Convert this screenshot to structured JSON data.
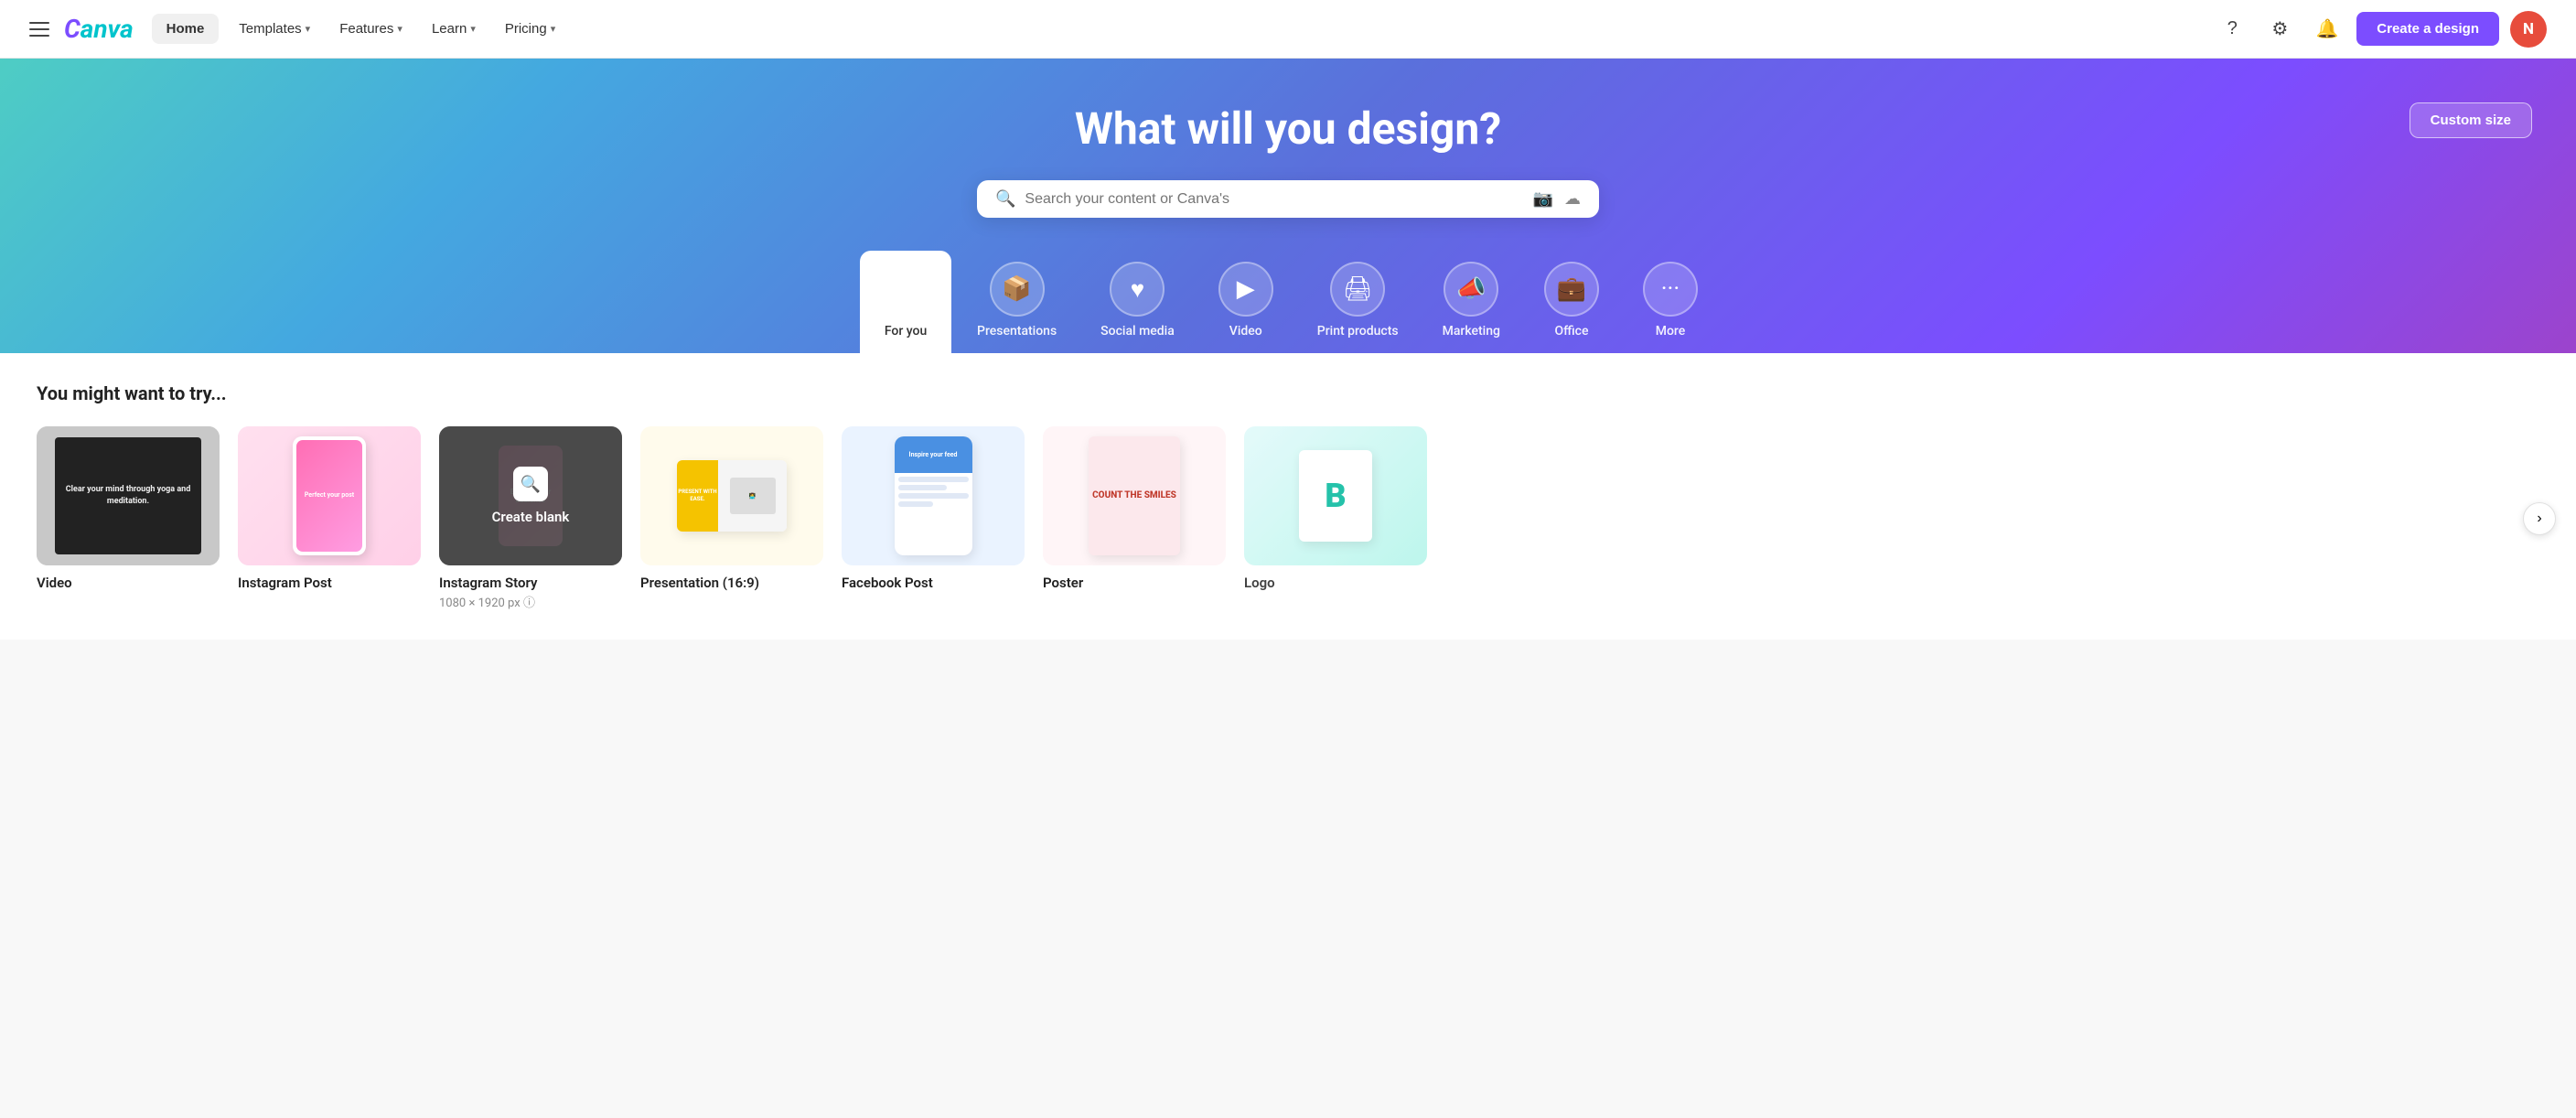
{
  "navbar": {
    "logo": "Canva",
    "home_label": "Home",
    "nav_items": [
      {
        "label": "Templates",
        "has_chevron": true
      },
      {
        "label": "Features",
        "has_chevron": true
      },
      {
        "label": "Learn",
        "has_chevron": true
      },
      {
        "label": "Pricing",
        "has_chevron": true
      }
    ],
    "create_label": "Create a design",
    "avatar_initials": "N",
    "help_icon": "question-circle-icon",
    "settings_icon": "gear-icon",
    "notifications_icon": "bell-icon"
  },
  "hero": {
    "title": "What will you design?",
    "search_placeholder": "Search your content or Canva's",
    "custom_size_label": "Custom size",
    "categories": [
      {
        "label": "For you",
        "icon": "✦",
        "active": true
      },
      {
        "label": "Presentations",
        "icon": "📦"
      },
      {
        "label": "Social media",
        "icon": "♥"
      },
      {
        "label": "Video",
        "icon": "▶"
      },
      {
        "label": "Print products",
        "icon": "🖨"
      },
      {
        "label": "Marketing",
        "icon": "📣"
      },
      {
        "label": "Office",
        "icon": "💼"
      },
      {
        "label": "More",
        "icon": "···"
      }
    ]
  },
  "main": {
    "section_title": "You might want to try...",
    "cards": [
      {
        "label": "Video",
        "sublabel": "",
        "type": "video"
      },
      {
        "label": "Instagram Post",
        "sublabel": "",
        "type": "instagram-post"
      },
      {
        "label": "Instagram Story",
        "sublabel": "1080 × 1920 px",
        "type": "instagram-story",
        "create_blank": true
      },
      {
        "label": "Presentation (16:9)",
        "sublabel": "",
        "type": "presentation"
      },
      {
        "label": "Facebook Post",
        "sublabel": "",
        "type": "fb-post"
      },
      {
        "label": "Poster",
        "sublabel": "",
        "type": "poster"
      },
      {
        "label": "Logo",
        "sublabel": "",
        "type": "logo"
      }
    ]
  }
}
